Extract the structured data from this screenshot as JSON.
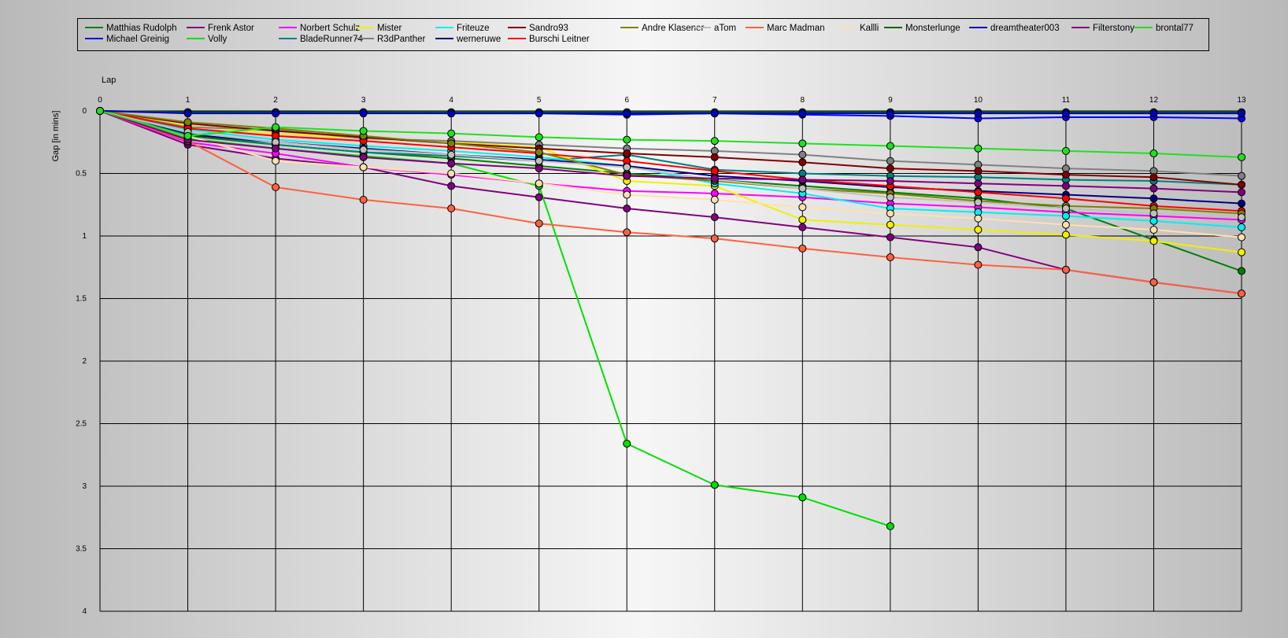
{
  "chart_data": {
    "type": "line",
    "xlabel": "Lap",
    "ylabel": "Gap [in mins]",
    "x": [
      0,
      1,
      2,
      3,
      4,
      5,
      6,
      7,
      8,
      9,
      10,
      11,
      12,
      13
    ],
    "xlim": [
      0,
      13
    ],
    "ylim": [
      0,
      4
    ],
    "y_ticks": [
      "0",
      "0.5",
      "1",
      "1.5",
      "2",
      "2.5",
      "3",
      "3.5",
      "4"
    ],
    "y_inverted": true,
    "grid": true,
    "legend_position": "top",
    "series": [
      {
        "name": "Matthias Rudolph",
        "color": "#008000",
        "values": [
          0,
          0.2,
          0.27,
          0.33,
          0.38,
          0.44,
          0.5,
          0.55,
          0.6,
          0.65,
          0.7,
          0.78,
          1.03,
          1.28
        ]
      },
      {
        "name": "Michael Greinig",
        "color": "#0000ff",
        "values": [
          0,
          0.01,
          0.01,
          0.01,
          0.02,
          0.02,
          0.03,
          0.02,
          0.03,
          0.04,
          0.06,
          0.05,
          0.05,
          0.06
        ]
      },
      {
        "name": "Frenk Astor",
        "color": "#800080",
        "values": [
          0,
          0.27,
          0.38,
          0.45,
          0.6,
          0.69,
          0.78,
          0.85,
          0.93,
          1.01,
          1.09,
          1.27,
          1.37,
          1.46
        ]
      },
      {
        "name": "Volly",
        "color": "#00e000",
        "values": [
          0,
          0.22,
          0.3,
          0.36,
          0.42,
          0.6,
          2.66,
          2.99,
          3.09,
          3.32
        ]
      },
      {
        "name": "Norbert Schulz",
        "color": "#ff00ff",
        "values": [
          0,
          0.25,
          0.34,
          0.45,
          0.51,
          0.58,
          0.64,
          0.66,
          0.69,
          0.74,
          0.77,
          0.81,
          0.84,
          0.87
        ]
      },
      {
        "name": "BladeRunner74",
        "color": "#008080",
        "values": [
          0,
          0.18,
          0.27,
          0.33,
          0.36,
          0.4,
          0.35,
          0.47,
          0.5,
          0.52,
          0.53,
          0.55,
          0.56,
          0.59
        ]
      },
      {
        "name": "Mister",
        "color": "#f0f000",
        "values": [
          0,
          0.12,
          0.18,
          0.22,
          0.25,
          0.29,
          0.56,
          0.6,
          0.87,
          0.91,
          0.95,
          0.99,
          1.04,
          1.13
        ]
      },
      {
        "name": "R3dPanther",
        "color": "#808080",
        "values": [
          0,
          0.13,
          0.15,
          0.22,
          0.24,
          0.27,
          0.3,
          0.32,
          0.35,
          0.4,
          0.43,
          0.46,
          0.48,
          0.52
        ]
      },
      {
        "name": "Friteuze",
        "color": "#00f0f0",
        "values": [
          0,
          0.15,
          0.23,
          0.28,
          0.32,
          0.37,
          0.44,
          0.58,
          0.66,
          0.78,
          0.81,
          0.84,
          0.88,
          0.93
        ]
      },
      {
        "name": "werneruwe",
        "color": "#000080",
        "values": [
          0,
          0.19,
          0.25,
          0.3,
          0.35,
          0.39,
          0.44,
          0.52,
          0.56,
          0.61,
          0.64,
          0.67,
          0.7,
          0.74
        ]
      },
      {
        "name": "Sandro93",
        "color": "#800000",
        "values": [
          0,
          0.1,
          0.16,
          0.21,
          0.26,
          0.3,
          0.34,
          0.37,
          0.41,
          0.46,
          0.48,
          0.51,
          0.53,
          0.59
        ]
      },
      {
        "name": "Burschi Leitner",
        "color": "#ff0000",
        "values": [
          0,
          0.14,
          0.2,
          0.24,
          0.29,
          0.34,
          0.4,
          0.48,
          0.55,
          0.6,
          0.65,
          0.7,
          0.76,
          0.8
        ]
      },
      {
        "name": "Andre Klasener",
        "color": "#808000",
        "values": [
          0,
          0.09,
          0.14,
          0.2,
          0.26,
          0.33,
          0.51,
          0.56,
          0.62,
          0.66,
          0.72,
          0.76,
          0.78,
          0.82
        ]
      },
      {
        "name": "aTom",
        "color": "#c0c0c0",
        "values": [
          0,
          0.17,
          0.25,
          0.31,
          0.35,
          0.4,
          0.45,
          0.55,
          0.62,
          0.69,
          0.73,
          0.78,
          0.82,
          0.85
        ]
      },
      {
        "name": "Marc Madman",
        "color": "#ff6040",
        "values": [
          0,
          0.24,
          0.61,
          0.71,
          0.78,
          0.9,
          0.97,
          1.02,
          1.1,
          1.17,
          1.23,
          1.27,
          1.37,
          1.46
        ]
      },
      {
        "name": "Kallli",
        "color": "#ffe0b0",
        "values": [
          0,
          0.2,
          0.4,
          0.45,
          0.5,
          0.58,
          0.67,
          0.71,
          0.77,
          0.82,
          0.86,
          0.91,
          0.95,
          1.01
        ]
      },
      {
        "name": "Monsterlunge",
        "color": "#006400",
        "values": [
          0,
          0.01,
          0.01,
          0.01,
          0.01,
          0.01,
          0.01,
          0.01,
          0.01,
          0.01,
          0.01,
          0.01,
          0.01,
          0.01
        ]
      },
      {
        "name": "dreamtheater003",
        "color": "#0000c0",
        "values": [
          0,
          0.02,
          0.02,
          0.02,
          0.02,
          0.02,
          0.02,
          0.02,
          0.02,
          0.02,
          0.02,
          0.02,
          0.02,
          0.02
        ]
      },
      {
        "name": "Filterstony",
        "color": "#800080",
        "values": [
          0,
          0.23,
          0.3,
          0.37,
          0.42,
          0.46,
          0.52,
          0.54,
          0.55,
          0.56,
          0.58,
          0.6,
          0.62,
          0.65
        ]
      },
      {
        "name": "brontal77",
        "color": "#20e020",
        "values": [
          0,
          0.2,
          0.13,
          0.16,
          0.18,
          0.21,
          0.23,
          0.24,
          0.26,
          0.28,
          0.3,
          0.32,
          0.34,
          0.37
        ]
      }
    ]
  }
}
